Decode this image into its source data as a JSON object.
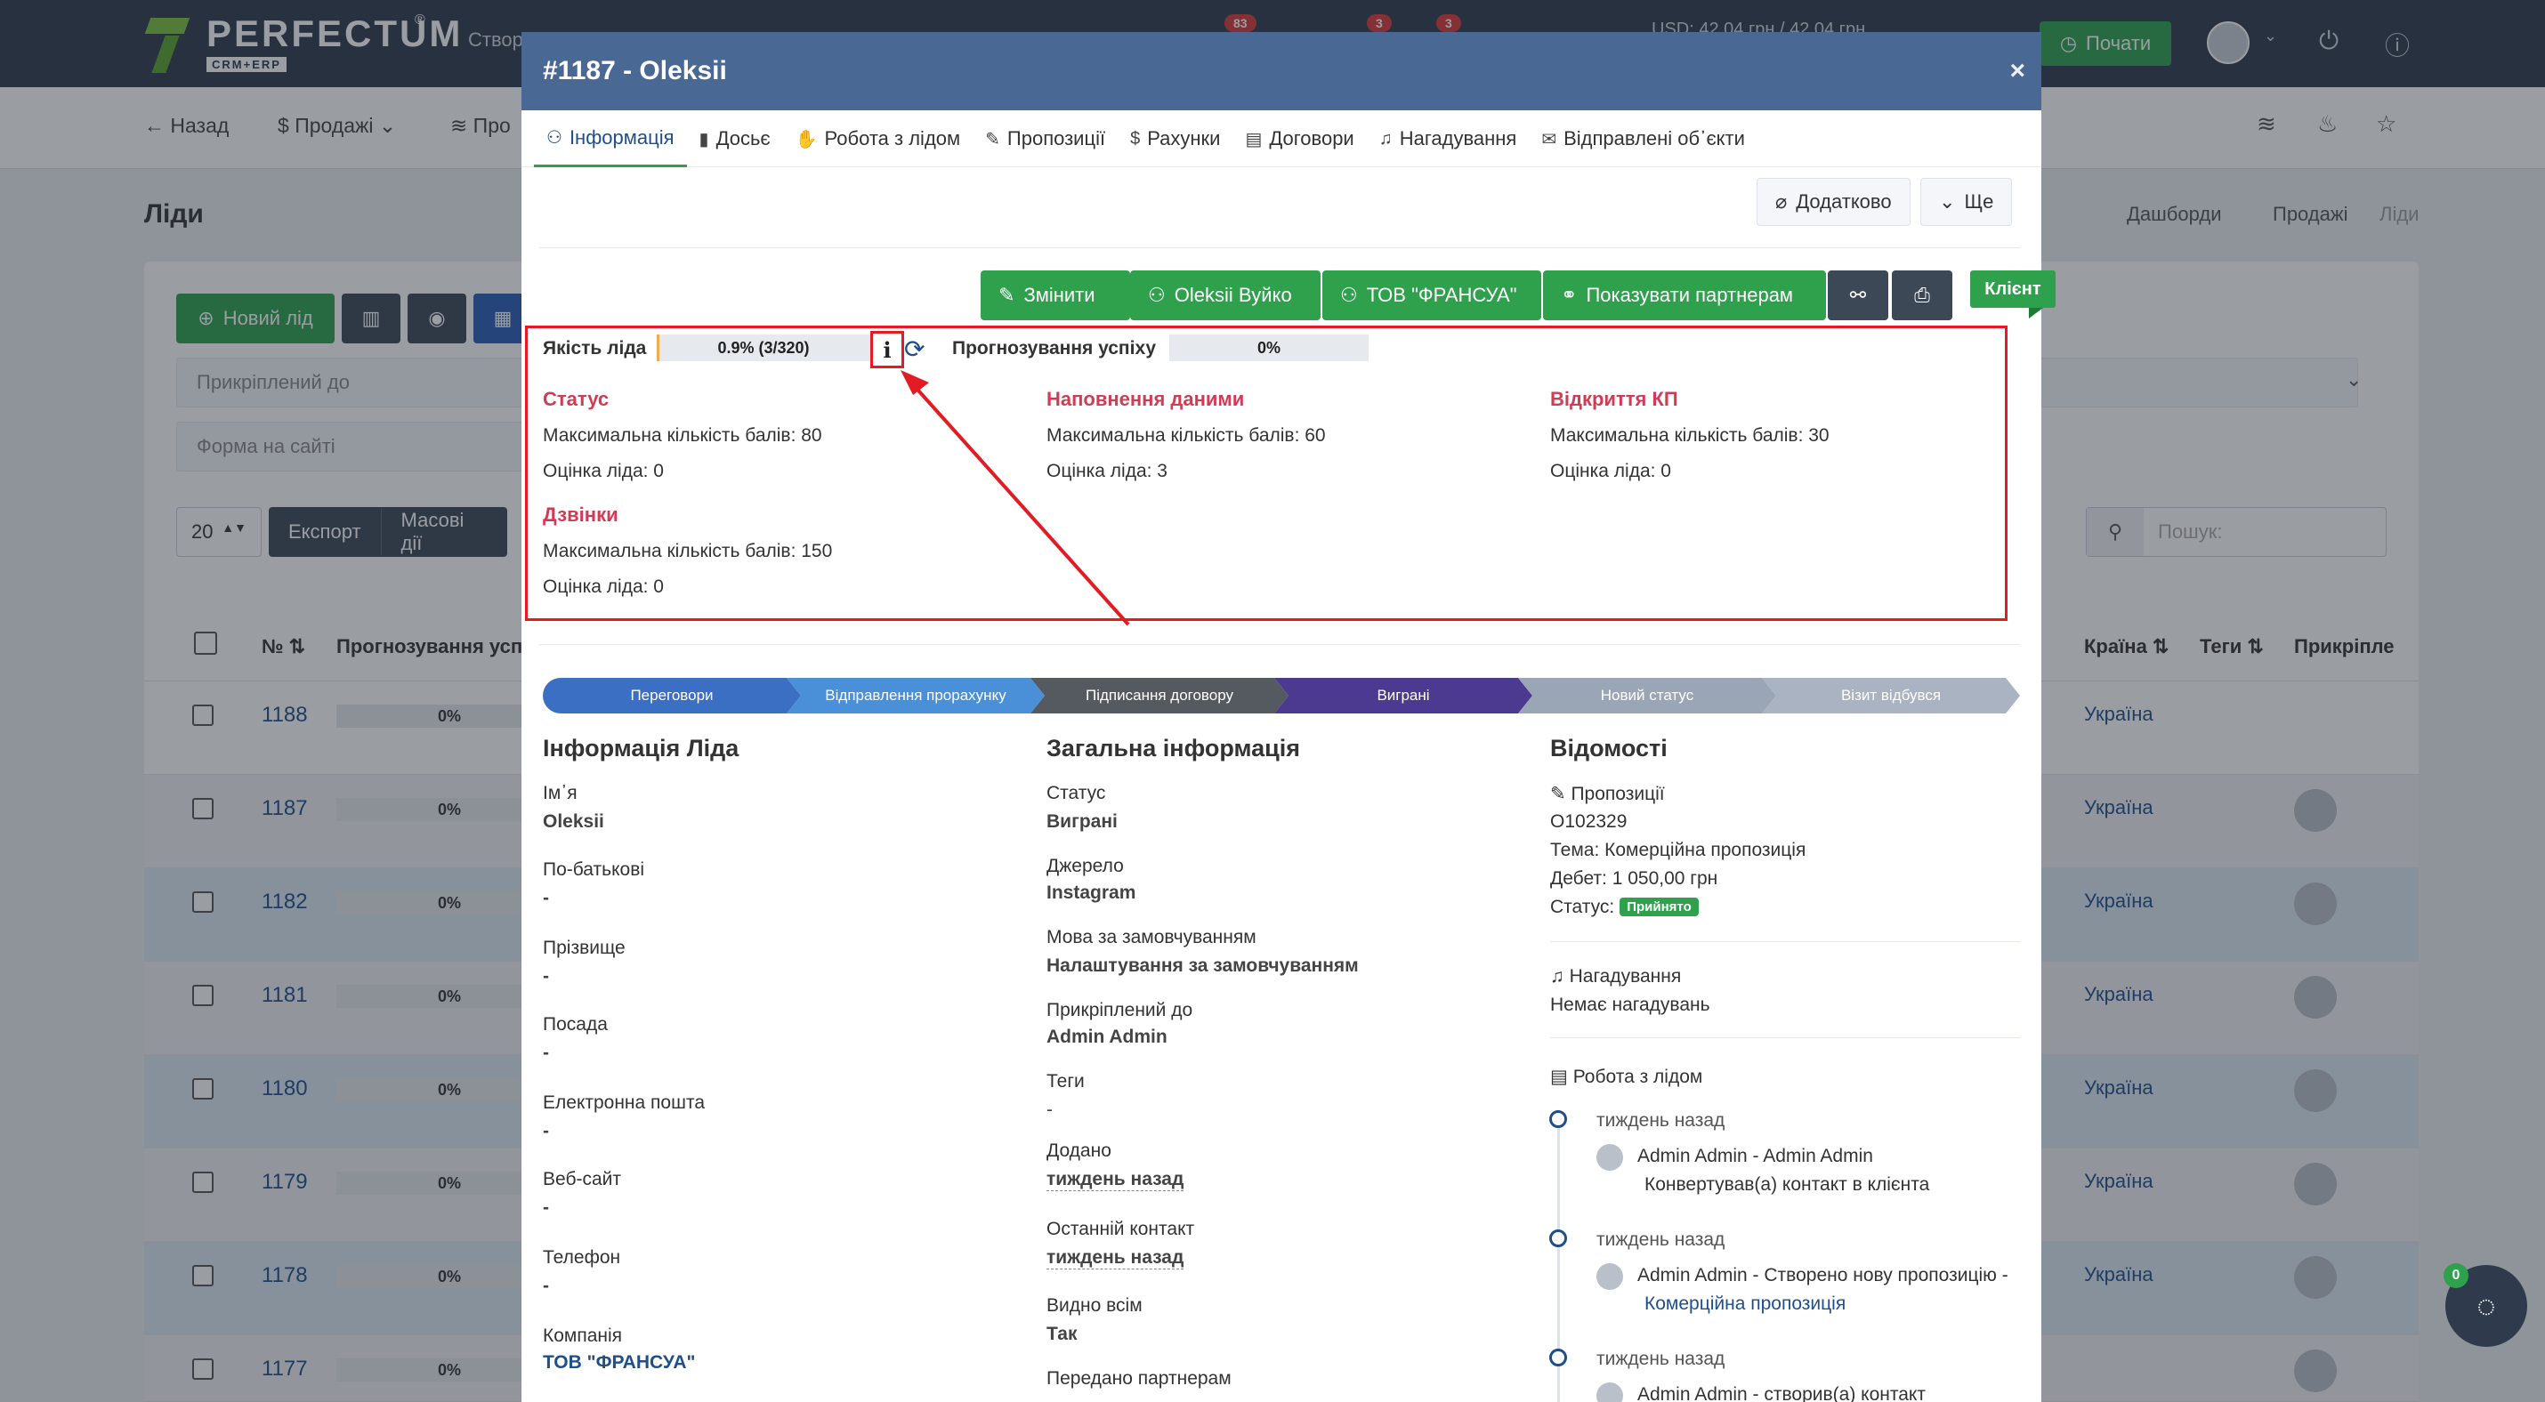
{
  "topbar": {
    "logo_text": "PERFECTUM",
    "logo_sub": "CRM+ERP",
    "logo_reg": "®",
    "create_label": "Створ",
    "badges": [
      "83",
      "3",
      "3"
    ],
    "currency": "USD: 42,04 грн / 42,04 грн",
    "start_label": "Почати"
  },
  "subbar": {
    "back": "Назад",
    "sales": "Продажі",
    "products": "Про"
  },
  "page": {
    "title": "Ліди",
    "breadcrumb": [
      "Дашборди",
      "Продажі",
      "Ліди"
    ]
  },
  "toolbar": {
    "new_lead": "Новий лід",
    "attached_placeholder": "Прикріплений до",
    "form_placeholder": "Форма на сайті",
    "page_size": "20",
    "export": "Експорт",
    "mass_actions": "Масові дії",
    "search_placeholder": "Пошук:"
  },
  "table": {
    "headers": [
      "№",
      "Прогнозування успіху",
      "Країна",
      "Теги",
      "Прикріпле"
    ],
    "rows": [
      {
        "id": "1188",
        "forecast": "0%",
        "country": "Україна"
      },
      {
        "id": "1187",
        "forecast": "0%",
        "country": "Україна"
      },
      {
        "id": "1182",
        "forecast": "0%",
        "country": "Україна"
      },
      {
        "id": "1181",
        "forecast": "0%",
        "country": "Україна"
      },
      {
        "id": "1180",
        "forecast": "0%",
        "country": "Україна"
      },
      {
        "id": "1179",
        "forecast": "0%",
        "country": "Україна"
      },
      {
        "id": "1178",
        "forecast": "0%",
        "country": "Україна"
      },
      {
        "id": "1177",
        "forecast": "0%",
        "country": "Україна"
      }
    ]
  },
  "modal": {
    "title": "#1187 - Oleksii",
    "close": "×",
    "tabs": [
      {
        "label": "Інформація",
        "icon": "user-icon"
      },
      {
        "label": "Досьє",
        "icon": "book-icon"
      },
      {
        "label": "Робота з лідом",
        "icon": "hand-icon"
      },
      {
        "label": "Пропозиції",
        "icon": "pencil-icon"
      },
      {
        "label": "Рахунки",
        "icon": "dollar-icon"
      },
      {
        "label": "Договори",
        "icon": "document-icon"
      },
      {
        "label": "Нагадування",
        "icon": "bell-icon"
      },
      {
        "label": "Відправлені об᾿єкти",
        "icon": "envelope-icon"
      }
    ],
    "extra_label": "Додатково",
    "more_label": "Ще",
    "actions": {
      "edit": "Змінити",
      "person": "Oleksii Вуйко",
      "company": "ТОВ \"ФРАНСУА\"",
      "show_partners": "Показувати партнерам"
    },
    "client_ribbon": "Клієнт",
    "quality": {
      "label": "Якість ліда",
      "value": "0.9% (3/320)",
      "fraction": 0.009,
      "forecast_label": "Прогнозування успіху",
      "forecast_value": "0%",
      "info_icon": "i"
    },
    "scores": [
      {
        "title": "Статус",
        "max": "Максимальна кількість балів: 80",
        "score": "Оцінка ліда: 0"
      },
      {
        "title": "Наповнення даними",
        "max": "Максимальна кількість балів: 60",
        "score": "Оцінка ліда: 3"
      },
      {
        "title": "Відкриття КП",
        "max": "Максимальна кількість балів: 30",
        "score": "Оцінка ліда: 0"
      },
      {
        "title": "Дзвінки",
        "max": "Максимальна кількість балів: 150",
        "score": "Оцінка ліда: 0"
      }
    ],
    "stages": [
      {
        "label": "Переговори",
        "color": "#3b6fc4"
      },
      {
        "label": "Відправлення прорахунку",
        "color": "#4a90d9"
      },
      {
        "label": "Підписання договору",
        "color": "#555a60"
      },
      {
        "label": "Виграні",
        "color": "#4b3a8f"
      },
      {
        "label": "Новий статус",
        "color": "#9aa6b6"
      },
      {
        "label": "Візит відбувся",
        "color": "#a9b3c1"
      }
    ],
    "lead_info": {
      "heading": "Інформація Ліда",
      "fields": [
        {
          "label": "Ім᾿я",
          "value": "Oleksii"
        },
        {
          "label": "По-батькові",
          "value": "-"
        },
        {
          "label": "Прізвище",
          "value": "-"
        },
        {
          "label": "Посада",
          "value": "-"
        },
        {
          "label": "Електронна пошта",
          "value": "-"
        },
        {
          "label": "Веб-сайт",
          "value": "-"
        },
        {
          "label": "Телефон",
          "value": "-"
        },
        {
          "label": "Компанія",
          "value": "ТОВ \"ФРАНСУА\""
        }
      ]
    },
    "general_info": {
      "heading": "Загальна інформація",
      "fields": [
        {
          "label": "Статус",
          "value": "Виграні"
        },
        {
          "label": "Джерело",
          "value": "Instagram"
        },
        {
          "label": "Мова за замовчуванням",
          "value": "Налаштування за замовчуванням"
        },
        {
          "label": "Прикріплений до",
          "value": "Admin Admin"
        },
        {
          "label": "Теги",
          "value": "-"
        },
        {
          "label": "Додано",
          "value": "тиждень назад"
        },
        {
          "label": "Останній контакт",
          "value": "тиждень назад"
        },
        {
          "label": "Видно всім",
          "value": "Так"
        },
        {
          "label": "Передано партнерам",
          "value": ""
        }
      ]
    },
    "details": {
      "heading": "Відомості",
      "proposals_title": "Пропозиції",
      "proposal_number": "О102329",
      "proposal_topic": "Тема: Комерційна пропозиція",
      "proposal_debit": "Дебет: 1 050,00 грн",
      "proposal_status_label": "Статус:",
      "proposal_status": "Прийнято",
      "reminders_title": "Нагадування",
      "reminders_empty": "Немає нагадувань",
      "work_title": "Робота з лідом",
      "timeline": [
        {
          "time": "тиждень назад",
          "line1": "Admin Admin - Admin Admin",
          "line2": "Конвертував(а) контакт в клієнта"
        },
        {
          "time": "тиждень назад",
          "line1": "Admin Admin - Створено нову пропозицію -",
          "line2": "Комерційна пропозиція"
        },
        {
          "time": "тиждень назад",
          "line1": "Admin Admin - створив(а) контакт",
          "line2": ""
        }
      ]
    }
  },
  "chat": {
    "badge": "0"
  }
}
